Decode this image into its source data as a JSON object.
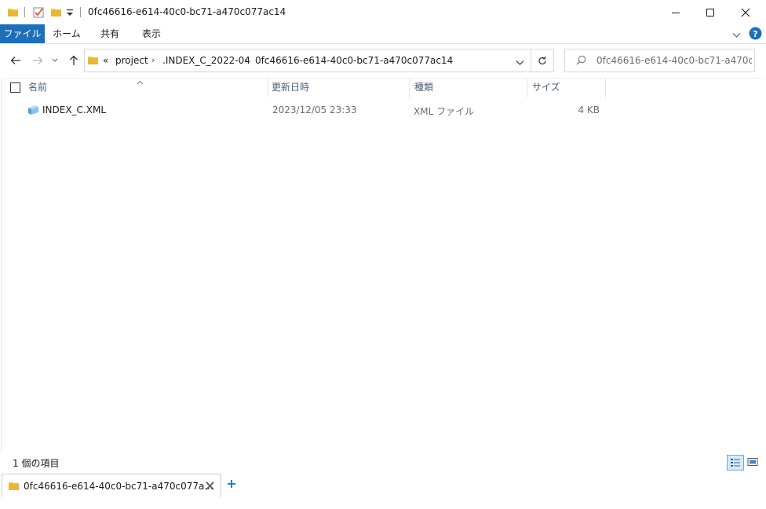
{
  "window": {
    "title": "0fc46616-e614-40c0-bc71-a470c077ac14",
    "controls": {
      "minimize": "minimize",
      "maximize": "maximize",
      "close": "close"
    }
  },
  "ribbon": {
    "tabs": [
      {
        "label": "ファイル",
        "active": true
      },
      {
        "label": "ホーム"
      },
      {
        "label": "共有"
      },
      {
        "label": "表示"
      }
    ]
  },
  "address_bar": {
    "overflow": "«",
    "breadcrumbs": [
      "project",
      ".INDEX_C_2022-04",
      "0fc46616-e614-40c0-bc71-a470c077ac14"
    ]
  },
  "search": {
    "placeholder": "0fc46616-e614-40c0-bc71-a470c077..."
  },
  "columns": {
    "name": "名前",
    "modified": "更新日時",
    "type": "種類",
    "size": "サイズ"
  },
  "files": [
    {
      "name": "INDEX_C.XML",
      "modified": "2023/12/05 23:33",
      "type": "XML ファイル",
      "size": "4 KB"
    }
  ],
  "status": {
    "item_count": "1 個の項目"
  },
  "window_tabs": [
    {
      "label": "0fc46616-e614-40c0-bc71-a470c077a..."
    }
  ],
  "colors": {
    "accent": "#1e6fba",
    "folder": "#f2c44f",
    "header_text": "#4c607a"
  }
}
